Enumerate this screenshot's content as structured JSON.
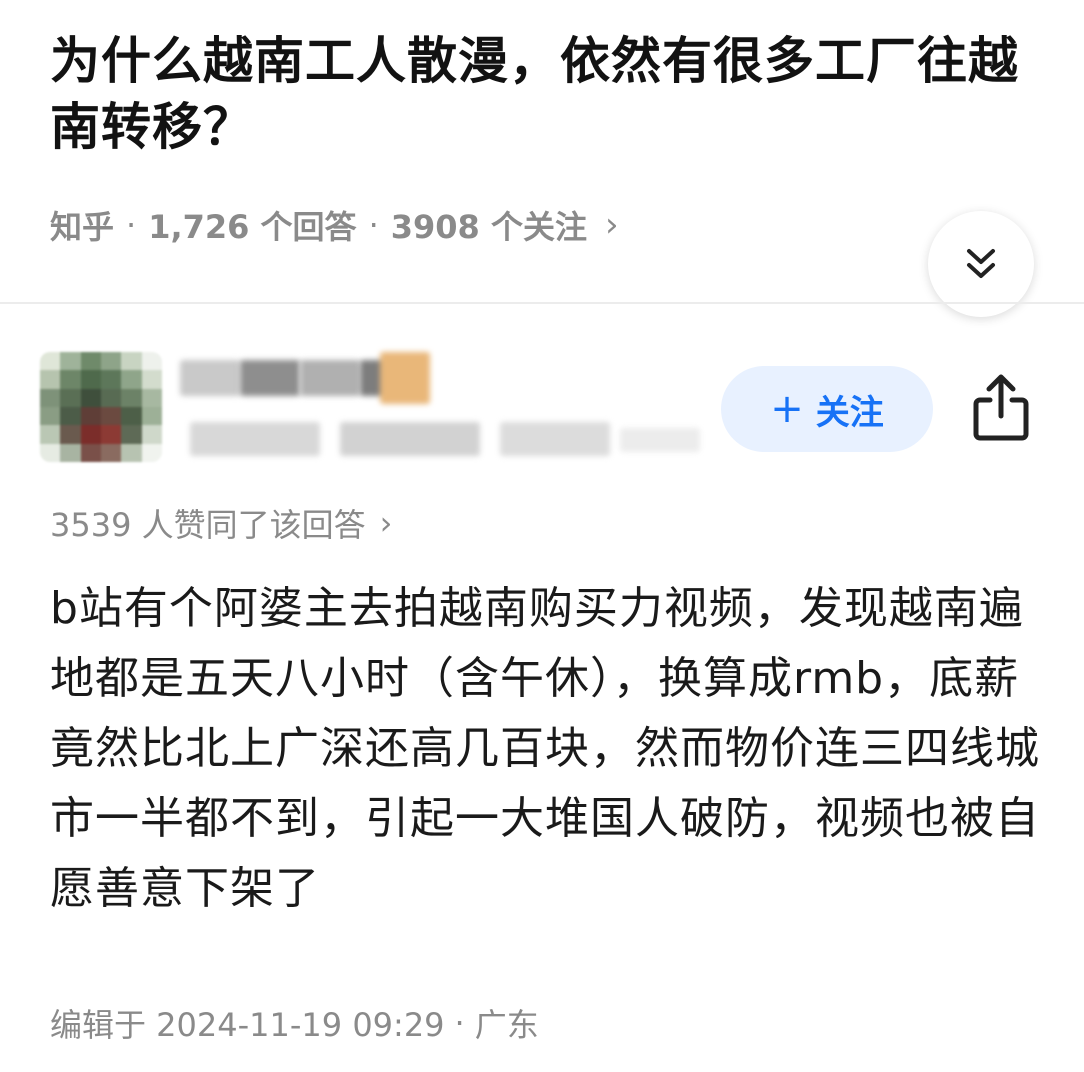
{
  "question": {
    "title": "为什么越南工人散漫，依然有很多工厂往越南转移？",
    "source": "知乎",
    "separator": "·",
    "answers_count": "1,726 个回答",
    "followers_count": "3908 个关注",
    "meta_chevron": "›"
  },
  "collapse_button": {
    "icon": "double-chevron-down-icon"
  },
  "author": {
    "name": "",
    "follow_label": "关注",
    "follow_plus": "+",
    "share_icon": "share-icon",
    "accent_color": "#1772f6"
  },
  "answer": {
    "upvote_text": "3539 人赞同了该回答",
    "upvote_chevron": "›",
    "content": "b站有个阿婆主去拍越南购买力视频，发现越南遍地都是五天八小时（含午休），换算成rmb，底薪竟然比北上广深还高几百块，然而物价连三四线城市一半都不到，引起一大堆国人破防，视频也被自愿善意下架了",
    "edited_label": "编辑于 2024-11-19 09:29",
    "separator": "·",
    "location": "广东"
  }
}
